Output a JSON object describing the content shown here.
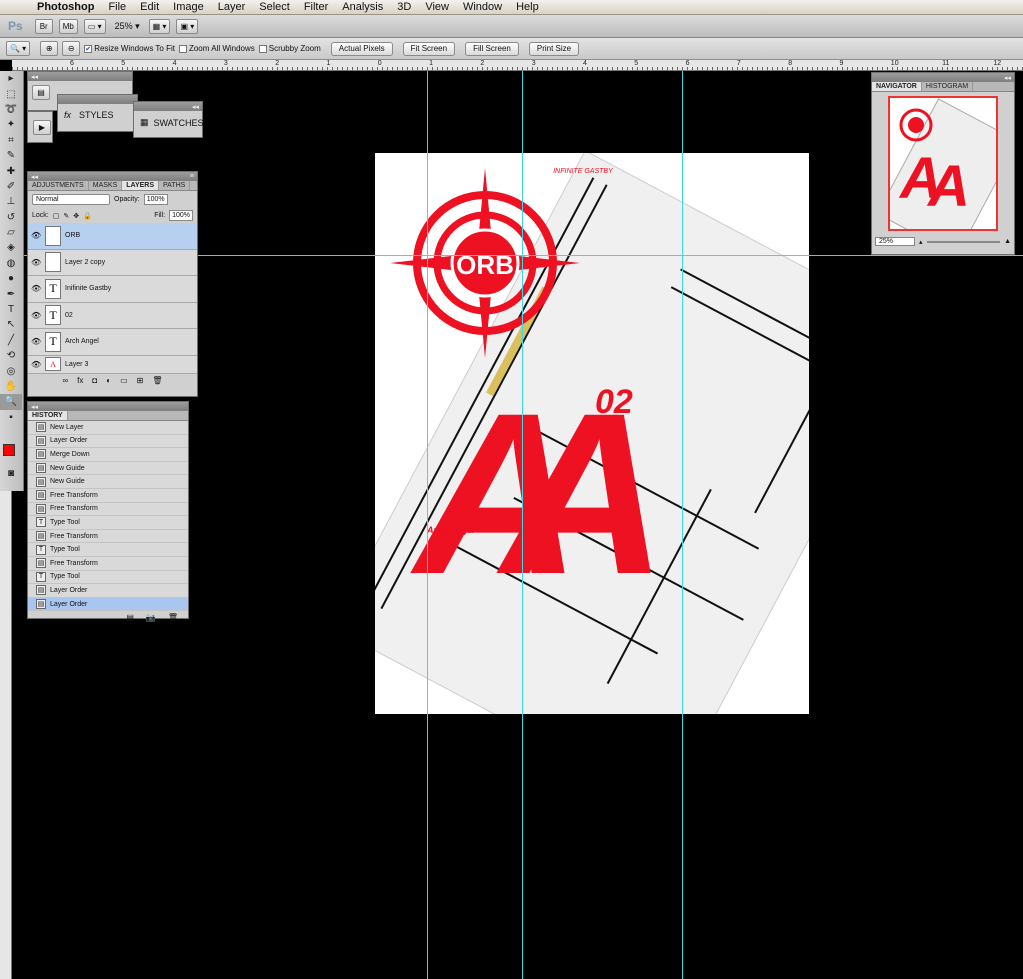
{
  "menubar": {
    "apple": "",
    "app": "Photoshop",
    "items": [
      "File",
      "Edit",
      "Image",
      "Layer",
      "Select",
      "Filter",
      "Analysis",
      "3D",
      "View",
      "Window",
      "Help"
    ]
  },
  "appbar": {
    "logo": "Ps",
    "br": "Br",
    "mb": "Mb",
    "zoom": "25% ▾"
  },
  "options": {
    "resize_windows": "Resize Windows To Fit",
    "zoom_all": "Zoom All Windows",
    "scrubby": "Scrubby Zoom",
    "actual_pixels": "Actual Pixels",
    "fit_screen": "Fit Screen",
    "fill_screen": "Fill Screen",
    "print_size": "Print Size"
  },
  "ruler": {
    "labels": [
      "6",
      "5",
      "4",
      "3",
      "2",
      "1",
      "0",
      "1",
      "2",
      "3",
      "4",
      "5",
      "6",
      "7",
      "8",
      "9",
      "10",
      "11",
      "12"
    ]
  },
  "mini_panels": {
    "styles": "STYLES",
    "swatches": "SWATCHES"
  },
  "layers_panel": {
    "tabs": [
      "ADJUSTMENTS",
      "MASKS",
      "LAYERS",
      "PATHS"
    ],
    "active_tab": "LAYERS",
    "blend_mode": "Normal",
    "opacity_label": "Opacity:",
    "opacity": "100%",
    "lock_label": "Lock:",
    "fill_label": "Fill:",
    "fill": "100%",
    "layers": [
      {
        "name": "ORB",
        "type": "image",
        "selected": true
      },
      {
        "name": "Layer 2 copy",
        "type": "image"
      },
      {
        "name": "Inifinite Gastby",
        "type": "text"
      },
      {
        "name": "02",
        "type": "text"
      },
      {
        "name": "Arch Angel",
        "type": "text"
      },
      {
        "name": "Layer 3",
        "type": "image"
      }
    ]
  },
  "history_panel": {
    "title": "HISTORY",
    "items": [
      {
        "label": "New Layer",
        "icon": "doc"
      },
      {
        "label": "Layer Order",
        "icon": "doc"
      },
      {
        "label": "Merge Down",
        "icon": "doc"
      },
      {
        "label": "New Guide",
        "icon": "doc"
      },
      {
        "label": "New Guide",
        "icon": "doc"
      },
      {
        "label": "Free Transform",
        "icon": "doc"
      },
      {
        "label": "Free Transform",
        "icon": "doc"
      },
      {
        "label": "Type Tool",
        "icon": "T"
      },
      {
        "label": "Free Transform",
        "icon": "doc"
      },
      {
        "label": "Type Tool",
        "icon": "T"
      },
      {
        "label": "Free Transform",
        "icon": "doc"
      },
      {
        "label": "Type Tool",
        "icon": "T"
      },
      {
        "label": "Layer Order",
        "icon": "doc"
      },
      {
        "label": "Layer Order",
        "icon": "doc",
        "selected": true
      }
    ]
  },
  "navigator": {
    "tabs": [
      "NAVIGATOR",
      "HISTOGRAM"
    ],
    "zoom": "25%"
  },
  "artwork": {
    "top_text": "INFINITE GASTBY",
    "orb": "ORB",
    "number": "02",
    "letters": "AA",
    "sub_text": "Arch Angel",
    "colors": {
      "red": "#ee1122",
      "paper": "#ffffff"
    }
  },
  "colors": {
    "foreground": "#ff0000",
    "background": "#ffffff",
    "guide": "#3fd6e6"
  }
}
